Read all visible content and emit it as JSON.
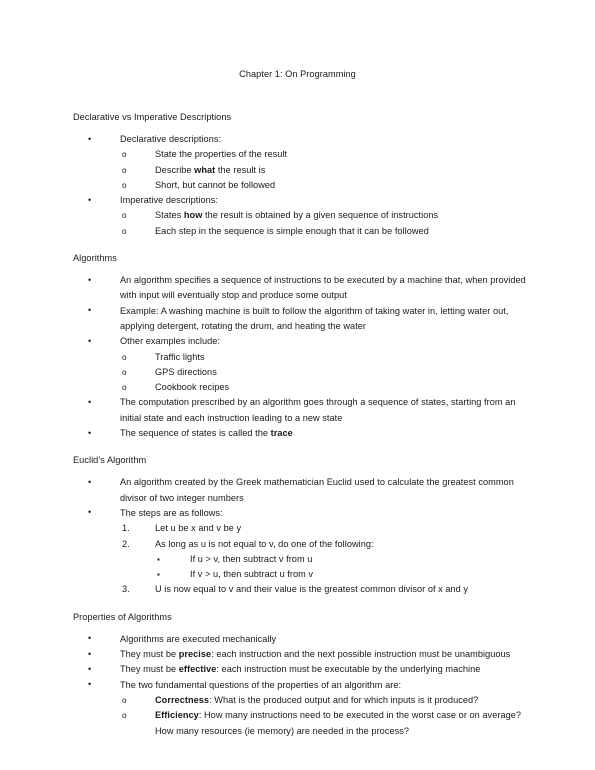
{
  "document": {
    "title": "Chapter 1: On Programming",
    "sections": [
      {
        "heading": "Declarative vs Imperative Descriptions",
        "items": [
          {
            "level": 1,
            "text": "Declarative descriptions:"
          },
          {
            "level": 2,
            "text": "State the properties of the result"
          },
          {
            "level": 2,
            "html": "Describe <b>what</b> the result is"
          },
          {
            "level": 2,
            "text": "Short, but cannot be followed"
          },
          {
            "level": 1,
            "text": "Imperative descriptions:"
          },
          {
            "level": 2,
            "html": "States <b>how</b> the result is obtained by a given sequence of instructions"
          },
          {
            "level": 2,
            "text": "Each step in the sequence is simple enough that it can be followed"
          }
        ]
      },
      {
        "heading": "Algorithms",
        "items": [
          {
            "level": 1,
            "text": "An algorithm specifies a sequence of instructions to be executed by a machine that, when provided with input will eventually stop and produce some output"
          },
          {
            "level": 1,
            "text": "Example: A washing machine is built to follow the algorithm of taking water in, letting water out, applying detergent, rotating the drum, and heating the water"
          },
          {
            "level": 1,
            "text": "Other examples include:"
          },
          {
            "level": 2,
            "text": "Traffic lights"
          },
          {
            "level": 2,
            "text": "GPS directions"
          },
          {
            "level": 2,
            "text": "Cookbook recipes"
          },
          {
            "level": 1,
            "text": "The computation prescribed by an algorithm goes through a sequence of states, starting from an initial state and each instruction leading to a new state"
          },
          {
            "level": 1,
            "html": "The sequence of states is called the <b>trace</b>"
          }
        ]
      },
      {
        "heading": "Euclid’s Algorithm",
        "items": [
          {
            "level": 1,
            "text": "An algorithm created by the Greek mathematician Euclid used to calculate the greatest common divisor of two integer numbers"
          },
          {
            "level": 1,
            "text": "The steps are as follows:"
          },
          {
            "level": 2,
            "number": "1.",
            "text": "Let u be x and v be y"
          },
          {
            "level": 2,
            "number": "2.",
            "text": "As long as u is not equal to v, do one of the following:"
          },
          {
            "level": 3,
            "text": "If u > v, then subtract v from u"
          },
          {
            "level": 3,
            "text": "If v > u, then subtract u from v"
          },
          {
            "level": 2,
            "number": "3.",
            "text": "U is now equal to v and their value is the greatest common divisor of x and y"
          }
        ]
      },
      {
        "heading": "Properties of Algorithms",
        "items": [
          {
            "level": 1,
            "text": "Algorithms are executed mechanically"
          },
          {
            "level": 1,
            "html": "They must be <b>precise</b>: each instruction and the next possible instruction must be unambiguous"
          },
          {
            "level": 1,
            "html": "They must be <b>effective</b>: each instruction must be executable by the underlying machine"
          },
          {
            "level": 1,
            "text": "The two fundamental questions of the properties of an algorithm are:"
          },
          {
            "level": 2,
            "html": "<b>Correctness</b>: What is the produced output and for which inputs is it produced?"
          },
          {
            "level": 2,
            "html": "<b>Efficiency</b>: How many instructions need to be executed in the worst case or on average? How many resources (ie memory) are needed in the process?"
          }
        ]
      }
    ]
  }
}
